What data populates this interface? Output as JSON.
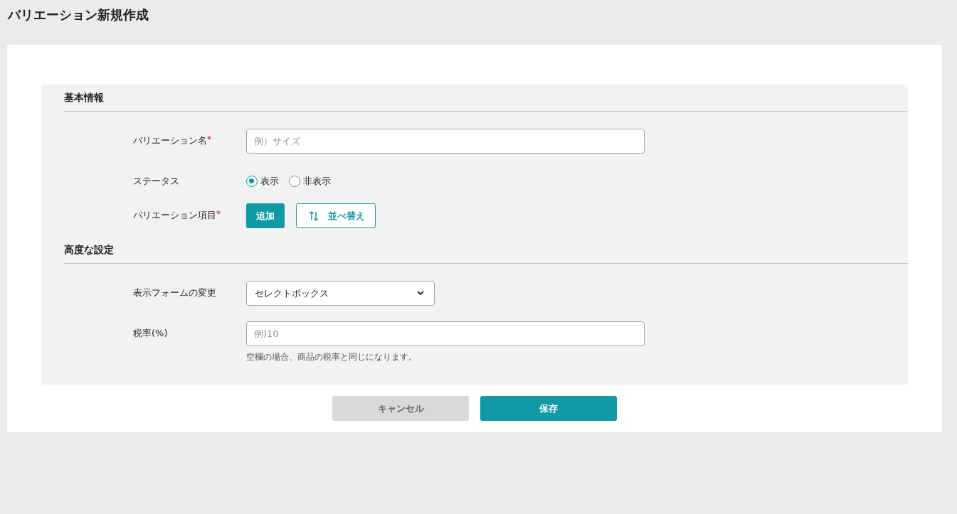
{
  "page_title": "バリエーション新規作成",
  "sections": [
    {
      "heading": "基本情報",
      "rows": [
        {
          "kind": "text",
          "label": "バリエーション名",
          "required_mark": "*",
          "placeholder": "例）サイズ"
        },
        {
          "kind": "radio",
          "label": "ステータス",
          "options": [
            {
              "label": "表示",
              "selected": true
            },
            {
              "label": "非表示",
              "selected": false
            }
          ]
        },
        {
          "kind": "buttons",
          "label": "バリエーション項目",
          "required_mark": "*",
          "buttons": [
            {
              "kind": "primary",
              "label": "追加"
            },
            {
              "kind": "sort",
              "label": "並べ替え"
            }
          ]
        }
      ]
    },
    {
      "heading": "高度な設定",
      "rows": [
        {
          "kind": "select",
          "label": "表示フォームの変更",
          "value": "セレクトボックス"
        },
        {
          "kind": "text",
          "label": "税率(%)",
          "placeholder": "例)10",
          "help": "空欄の場合、商品の税率と同じになります。"
        }
      ]
    }
  ],
  "footer_buttons": [
    {
      "kind": "cancel",
      "label": "キャンセル"
    },
    {
      "kind": "save",
      "label": "保存"
    }
  ]
}
